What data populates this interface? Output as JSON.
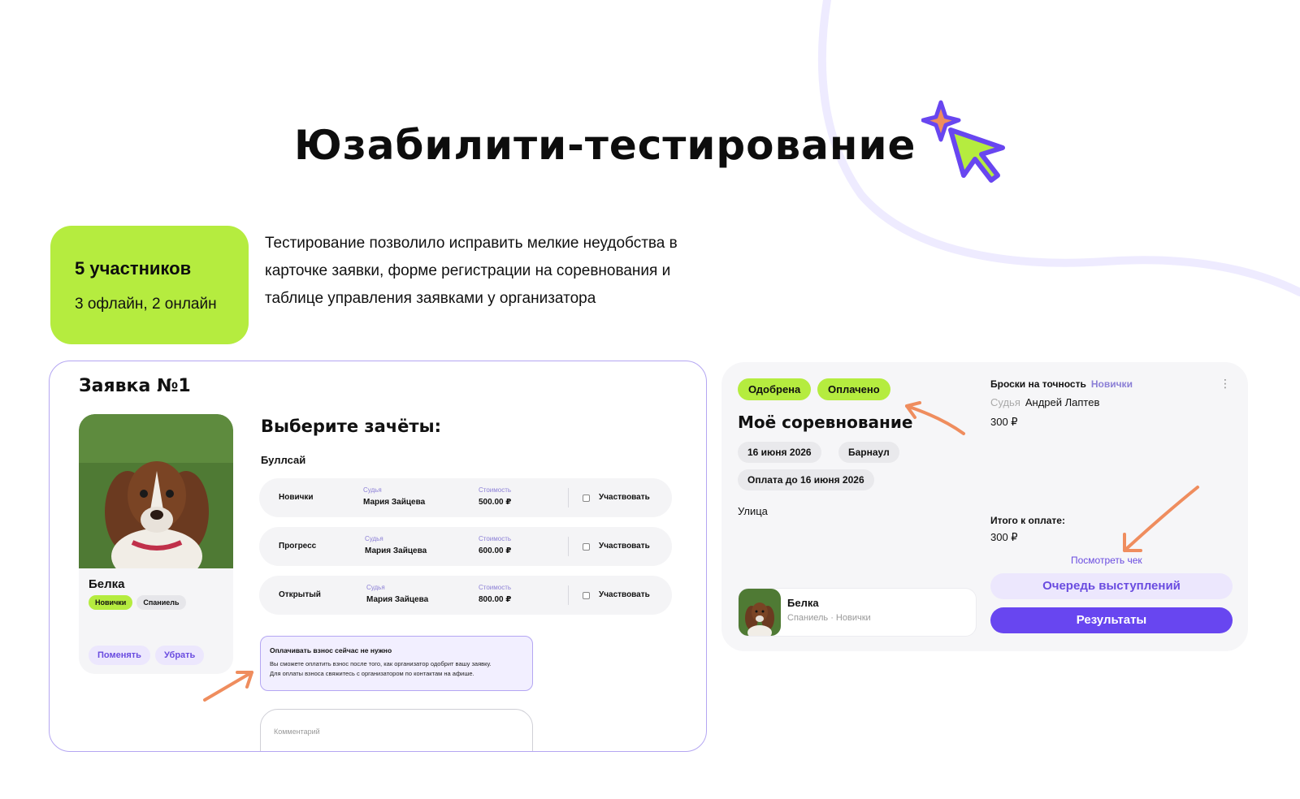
{
  "page": {
    "title": "Юзабилити-тестирование",
    "stats": {
      "count": "5 участников",
      "split": "3 офлайн, 2 онлайн"
    },
    "intro": "Тестирование позволило исправить мелкие неудобства в карточке заявки, форме регистрации на соревнования и таблице управления заявками у организатора"
  },
  "application": {
    "title": "Заявка №1",
    "pet": {
      "name": "Белка",
      "tags": [
        "Новички",
        "Спаниель"
      ]
    },
    "pet_actions": {
      "change": "Поменять",
      "remove": "Убрать"
    },
    "choose_title": "Выберите зачёты:",
    "discipline": "Буллсай",
    "labels": {
      "judge": "Судья",
      "cost": "Стоимость",
      "participate": "Участвовать"
    },
    "events": [
      {
        "name": "Новички",
        "judge": "Мария Зайцева",
        "cost": "500.00 ₽",
        "checked": false
      },
      {
        "name": "Прогресс",
        "judge": "Мария Зайцева",
        "cost": "600.00 ₽",
        "checked": false
      },
      {
        "name": "Открытый",
        "judge": "Мария Зайцева",
        "cost": "800.00 ₽",
        "checked": false
      }
    ],
    "note": {
      "title": "Оплачивать взнос сейчас не нужно",
      "line1": "Вы сможете оплатить взнос после того, как организатор одобрит вашу заявку.",
      "line2": "Для оплаты взноса свяжитесь с организатором по контактам на афише."
    },
    "comment_placeholder": "Комментарий"
  },
  "competition": {
    "statuses": [
      "Одобрена",
      "Оплачено"
    ],
    "title": "Моё соревнование",
    "date": "16 июня 2026",
    "city": "Барнаул",
    "pay_until": "Оплата до 16 июня 2026",
    "street": "Улица",
    "pet": {
      "name": "Белка",
      "sub": "Спаниель · Новички"
    },
    "event": {
      "name": "Броски на точность",
      "level": "Новички",
      "judge_label": "Судья",
      "judge": "Андрей Лаптев",
      "price": "300 ₽"
    },
    "total_label": "Итого к оплате:",
    "total": "300 ₽",
    "view_receipt": "Посмотреть чек",
    "queue_button": "Очередь выступлений",
    "results_button": "Результаты"
  },
  "colors": {
    "accent_green": "#b5ec3f",
    "accent_purple": "#6846f0",
    "soft_purple": "#ece7fd",
    "arrow_orange": "#ef8d5e"
  }
}
